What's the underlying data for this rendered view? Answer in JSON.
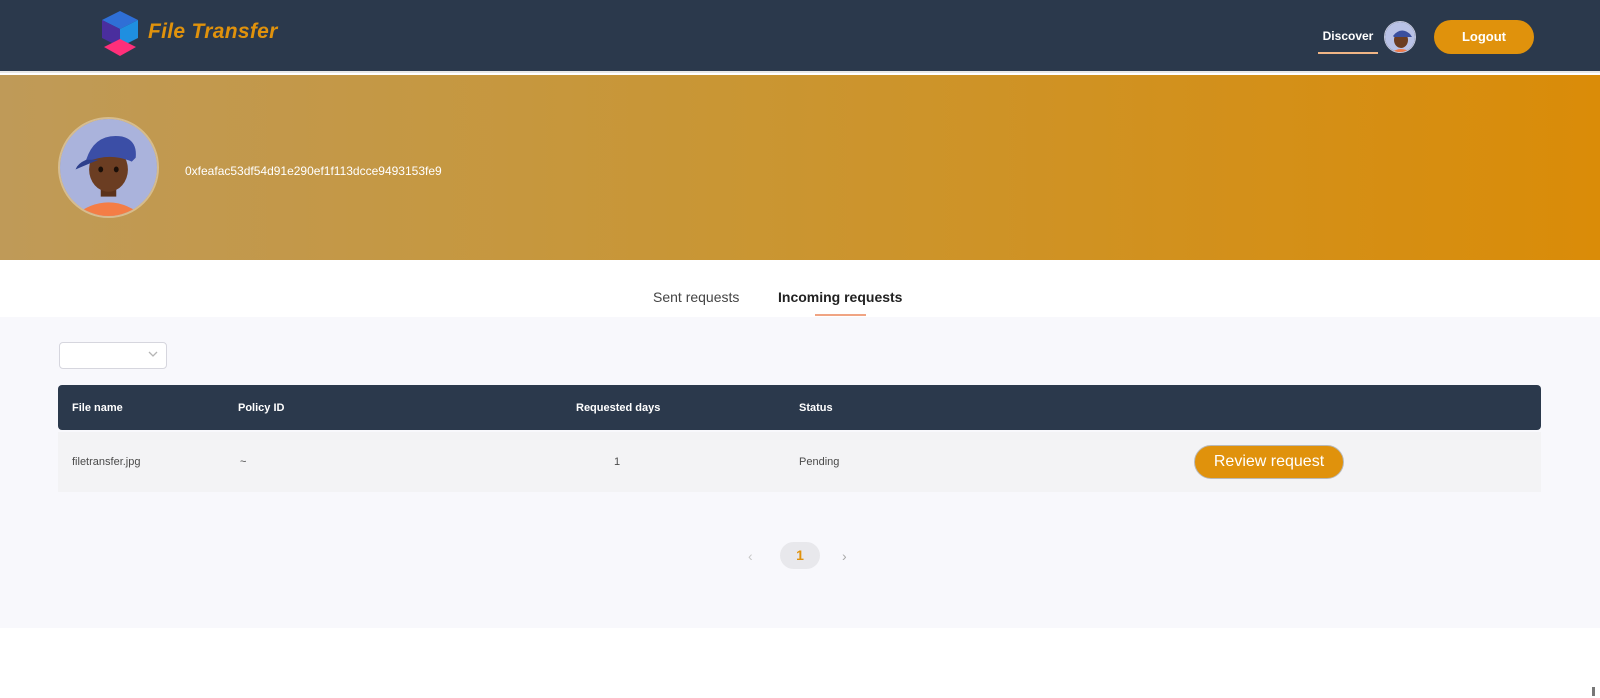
{
  "header": {
    "logo_text": "File Transfer",
    "nav_discover": "Discover",
    "logout_label": "Logout"
  },
  "profile": {
    "address": "0xfeafac53df54d91e290ef1f113dcce9493153fe9"
  },
  "tabs": [
    {
      "label": "Sent requests",
      "active": false
    },
    {
      "label": "Incoming requests",
      "active": true
    }
  ],
  "filter": {
    "value": ""
  },
  "table": {
    "columns": [
      "File name",
      "Policy ID",
      "Requested days",
      "Status"
    ],
    "rows": [
      {
        "file_name": "filetransfer.jpg",
        "policy_id": "~",
        "requested_days": "1",
        "status": "Pending",
        "action_label": "Review request"
      }
    ]
  },
  "pagination": {
    "prev": "‹",
    "current": "1",
    "next": "›"
  },
  "colors": {
    "accent": "#e0920c",
    "header_bg": "#2b394c"
  }
}
